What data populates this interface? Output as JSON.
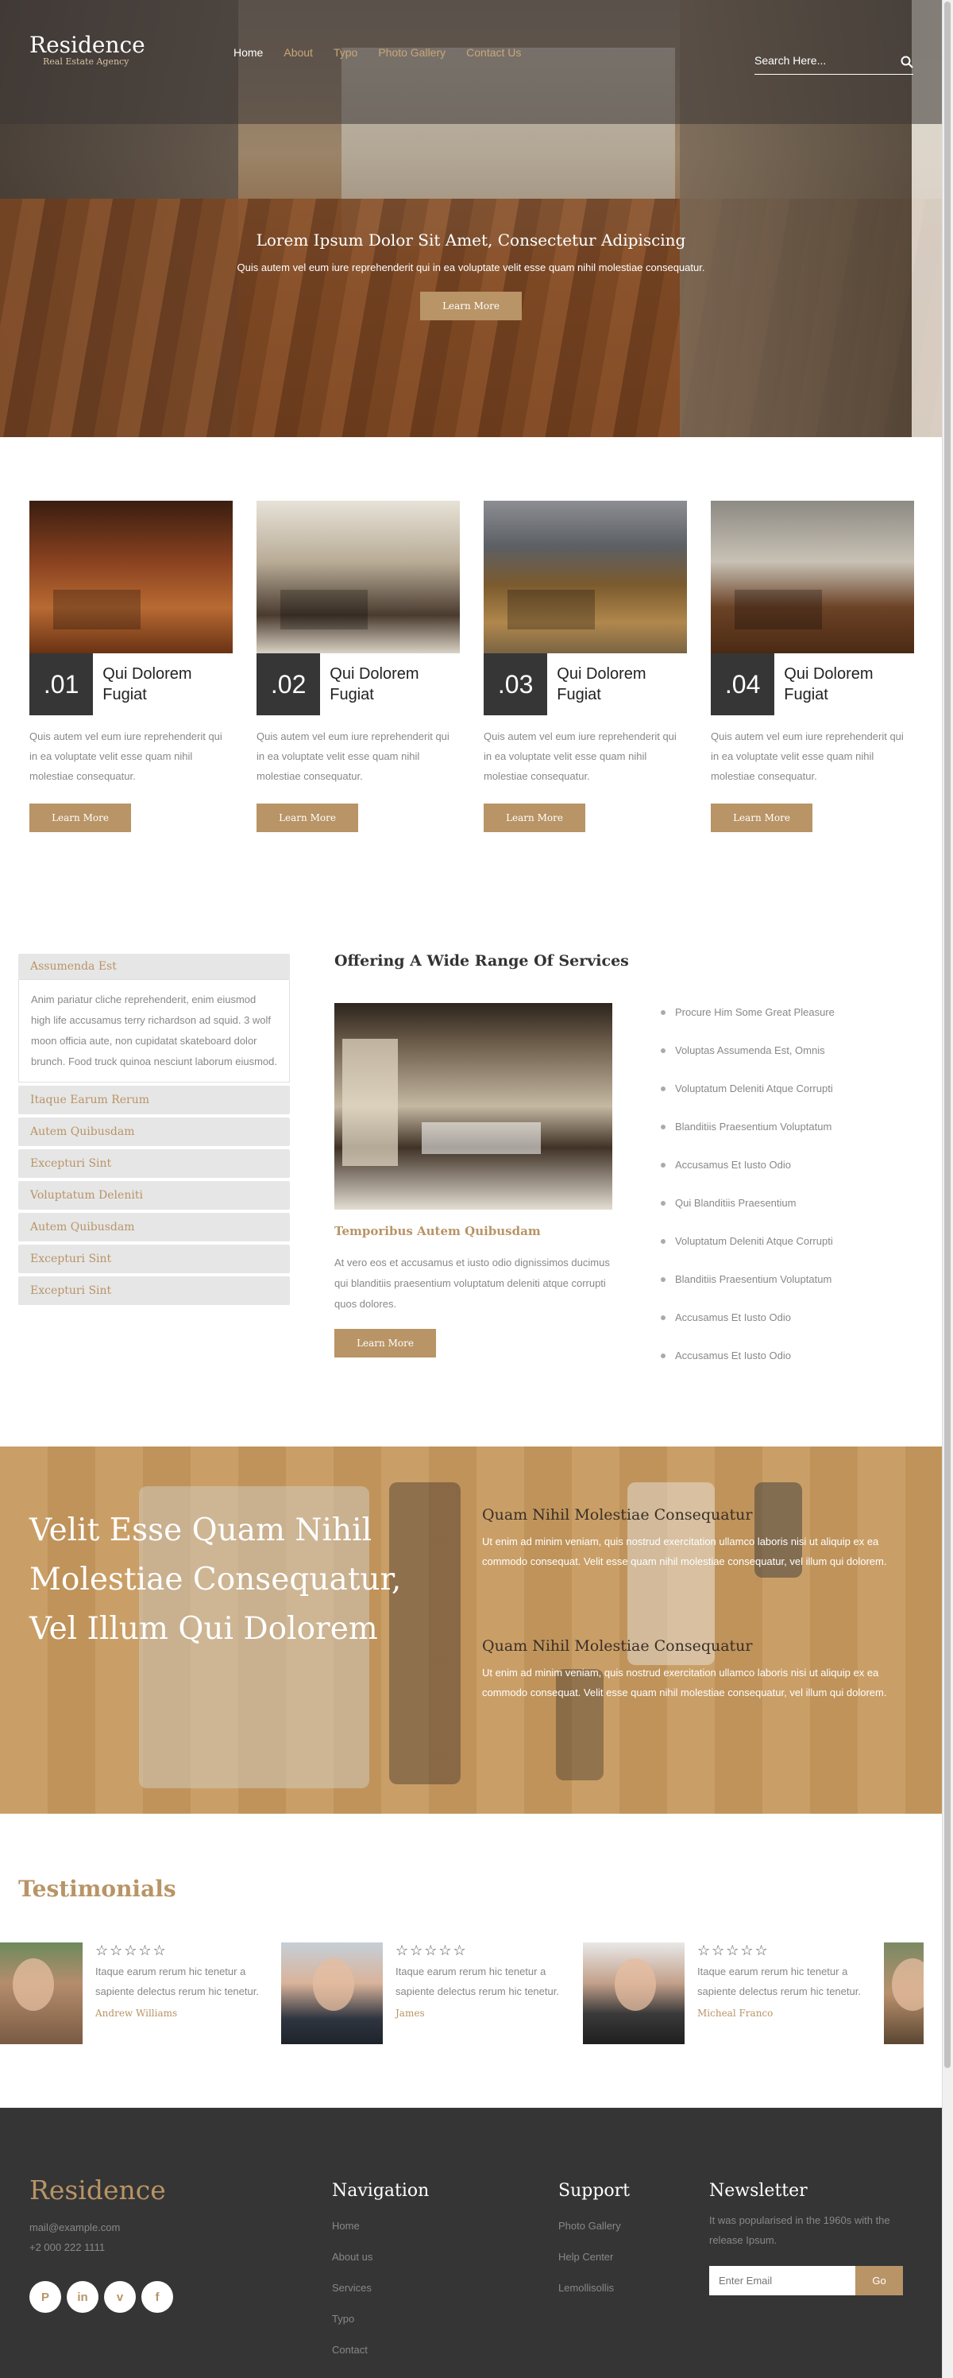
{
  "header": {
    "logo_name": "Residence",
    "logo_tagline": "Real Estate Agency",
    "nav": [
      "Home",
      "About",
      "Typo",
      "Photo Gallery",
      "Contact Us"
    ],
    "search_placeholder": "Search Here..."
  },
  "hero": {
    "title": "Lorem Ipsum Dolor Sit Amet, Consectetur Adipiscing",
    "subtitle": "Quis autem vel eum iure reprehenderit qui in ea voluptate velit esse quam nihil molestiae consequatur.",
    "button": "Learn More"
  },
  "cards": [
    {
      "num": ".01",
      "title": "Qui Dolorem Fugiat",
      "desc": "Quis autem vel eum iure reprehenderit qui in ea voluptate velit esse quam nihil molestiae consequatur.",
      "button": "Learn More"
    },
    {
      "num": ".02",
      "title": "Qui Dolorem Fugiat",
      "desc": "Quis autem vel eum iure reprehenderit qui in ea voluptate velit esse quam nihil molestiae consequatur.",
      "button": "Learn More"
    },
    {
      "num": ".03",
      "title": "Qui Dolorem Fugiat",
      "desc": "Quis autem vel eum iure reprehenderit qui in ea voluptate velit esse quam nihil molestiae consequatur.",
      "button": "Learn More"
    },
    {
      "num": ".04",
      "title": "Qui Dolorem Fugiat",
      "desc": "Quis autem vel eum iure reprehenderit qui in ea voluptate velit esse quam nihil molestiae consequatur.",
      "button": "Learn More"
    }
  ],
  "accordion": {
    "open_title": "Assumenda Est",
    "open_body": "Anim pariatur cliche reprehenderit, enim eiusmod high life accusamus terry richardson ad squid. 3 wolf moon officia aute, non cupidatat skateboard dolor brunch. Food truck quinoa nesciunt laborum eiusmod.",
    "items": [
      "Itaque Earum Rerum",
      "Autem Quibusdam",
      "Excepturi Sint",
      "Voluptatum Deleniti",
      "Autem Quibusdam",
      "Excepturi Sint",
      "Excepturi Sint"
    ]
  },
  "services": {
    "title": "Offering A Wide Range Of Services",
    "subtitle": "Temporibus Autem Quibusdam",
    "desc": "At vero eos et accusamus et iusto odio dignissimos ducimus qui blanditiis praesentium voluptatum deleniti atque corrupti quos dolores.",
    "button": "Learn More",
    "list": [
      "Procure Him Some Great Pleasure",
      "Voluptas Assumenda Est, Omnis",
      "Voluptatum Deleniti Atque Corrupti",
      "Blanditiis Praesentium Voluptatum",
      "Accusamus Et Iusto Odio",
      "Qui Blanditiis Praesentium",
      "Voluptatum Deleniti Atque Corrupti",
      "Blanditiis Praesentium Voluptatum",
      "Accusamus Et Iusto Odio",
      "Accusamus Et Iusto Odio"
    ]
  },
  "banner": {
    "heading": "Velit Esse Quam Nihil Molestiae Consequatur, Vel Illum Qui Dolorem",
    "features": [
      {
        "title": "Quam Nihil Molestiae Consequatur",
        "text": "Ut enim ad minim veniam, quis nostrud exercitation ullamco laboris nisi ut aliquip ex ea commodo consequat. Velit esse quam nihil molestiae consequatur, vel illum qui dolorem."
      },
      {
        "title": "Quam Nihil Molestiae Consequatur",
        "text": "Ut enim ad minim veniam, quis nostrud exercitation ullamco laboris nisi ut aliquip ex ea commodo consequat. Velit esse quam nihil molestiae consequatur, vel illum qui dolorem."
      }
    ]
  },
  "testimonials": {
    "title": "Testimonials",
    "items": [
      {
        "stars": "☆☆☆☆☆",
        "quote": "Itaque earum rerum hic tenetur a sapiente delectus rerum hic tenetur.",
        "author": "Andrew Williams"
      },
      {
        "stars": "☆☆☆☆☆",
        "quote": "Itaque earum rerum hic tenetur a sapiente delectus rerum hic tenetur.",
        "author": "James"
      },
      {
        "stars": "☆☆☆☆☆",
        "quote": "Itaque earum rerum hic tenetur a sapiente delectus rerum hic tenetur.",
        "author": "Micheal Franco"
      }
    ]
  },
  "footer": {
    "logo": "Residence",
    "email": "mail@example.com",
    "phone": "+2 000 222 1111",
    "social": [
      "P",
      "in",
      "v",
      "f"
    ],
    "navigation_title": "Navigation",
    "navigation": [
      "Home",
      "About us",
      "Services",
      "Typo",
      "Contact"
    ],
    "support_title": "Support",
    "support": [
      "Photo Gallery",
      "Help Center",
      "Lemollisollis"
    ],
    "newsletter_title": "Newsletter",
    "newsletter_text": "It was popularised in the 1960s with the release Ipsum.",
    "newsletter_placeholder": "Enter Email",
    "newsletter_button": "Go"
  },
  "colors": {
    "accent": "#b89466",
    "dark": "#353535",
    "banner": "#c7995e"
  }
}
